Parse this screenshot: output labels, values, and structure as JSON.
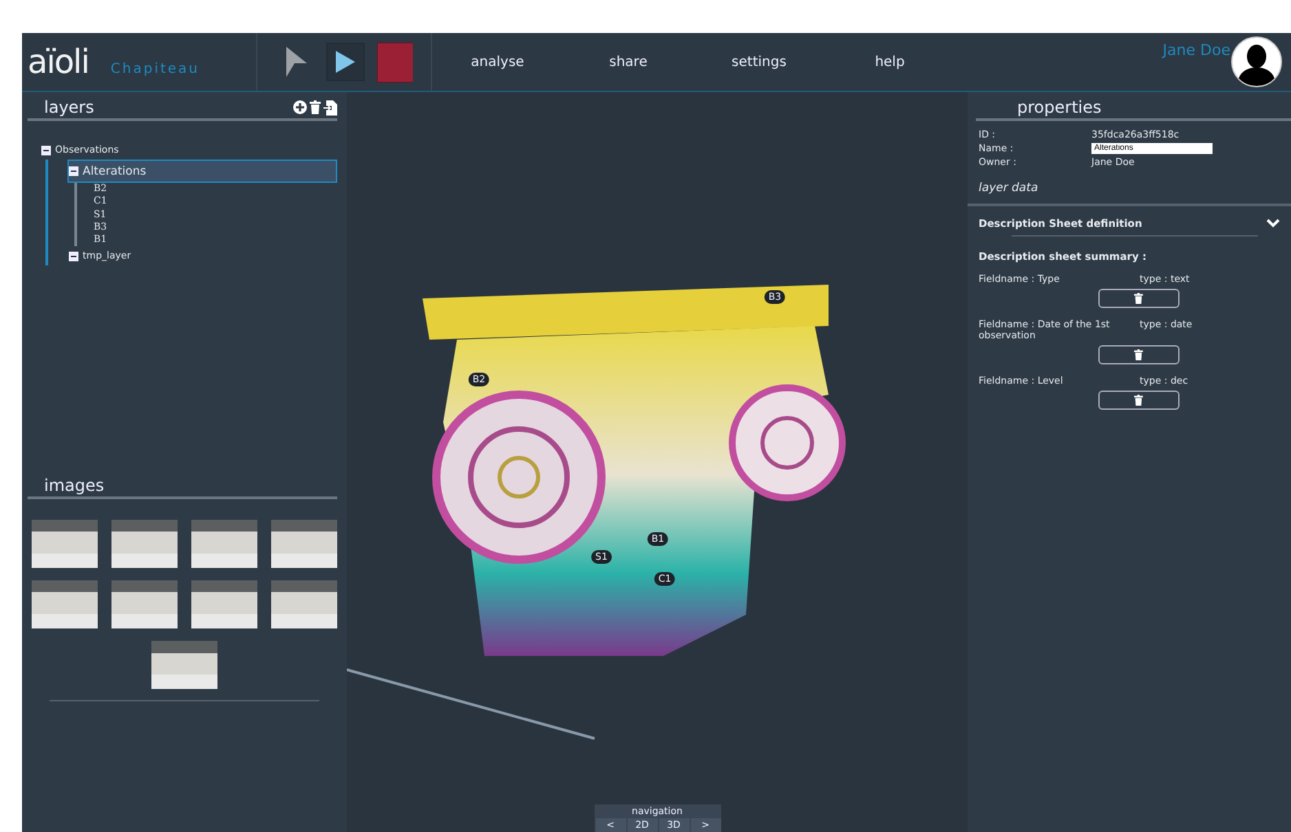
{
  "header": {
    "logo": "aïoli",
    "project": "Chapiteau",
    "tools": [
      {
        "kind": "pointer",
        "selected": false
      },
      {
        "kind": "play",
        "selected": true
      },
      {
        "kind": "stop",
        "selected": false
      }
    ],
    "menu": [
      "analyse",
      "share",
      "settings",
      "help"
    ],
    "user": "Jane Doe"
  },
  "layers": {
    "title": "layers",
    "tree": [
      {
        "label": "Observations",
        "expanded": true,
        "selected": false,
        "children": [
          {
            "label": "Alterations",
            "expanded": true,
            "selected": true,
            "children": [
              {
                "label": "B2"
              },
              {
                "label": "C1"
              },
              {
                "label": "S1"
              },
              {
                "label": "B3"
              },
              {
                "label": "B1"
              }
            ]
          },
          {
            "label": "tmp_layer",
            "expanded": true,
            "selected": false
          }
        ]
      }
    ]
  },
  "images": {
    "title": "images"
  },
  "viewer": {
    "markers": [
      "B3",
      "B2",
      "B1",
      "S1",
      "C1"
    ],
    "navigation": {
      "title": "navigation",
      "buttons": [
        "<",
        "2D",
        "3D",
        ">"
      ]
    }
  },
  "properties": {
    "title": "properties",
    "fields": [
      {
        "label": "ID :",
        "kind": "text",
        "value": "35fdca26a3ff518c"
      },
      {
        "label": "Name :",
        "kind": "input",
        "value": "Alterations"
      },
      {
        "label": "Owner :",
        "kind": "text",
        "value": "Jane Doe"
      }
    ],
    "layer_data": "layer data",
    "sheet_title": "Description Sheet definition",
    "expanded": true,
    "summary_title": "Description sheet summary :",
    "sheet_fields": [
      {
        "name": "Fieldname : Type",
        "type": "type : text"
      },
      {
        "name": "Fieldname : Date of the 1st observation",
        "type": "type : date"
      },
      {
        "name": "Fieldname : Level",
        "type": "type : dec"
      }
    ]
  }
}
